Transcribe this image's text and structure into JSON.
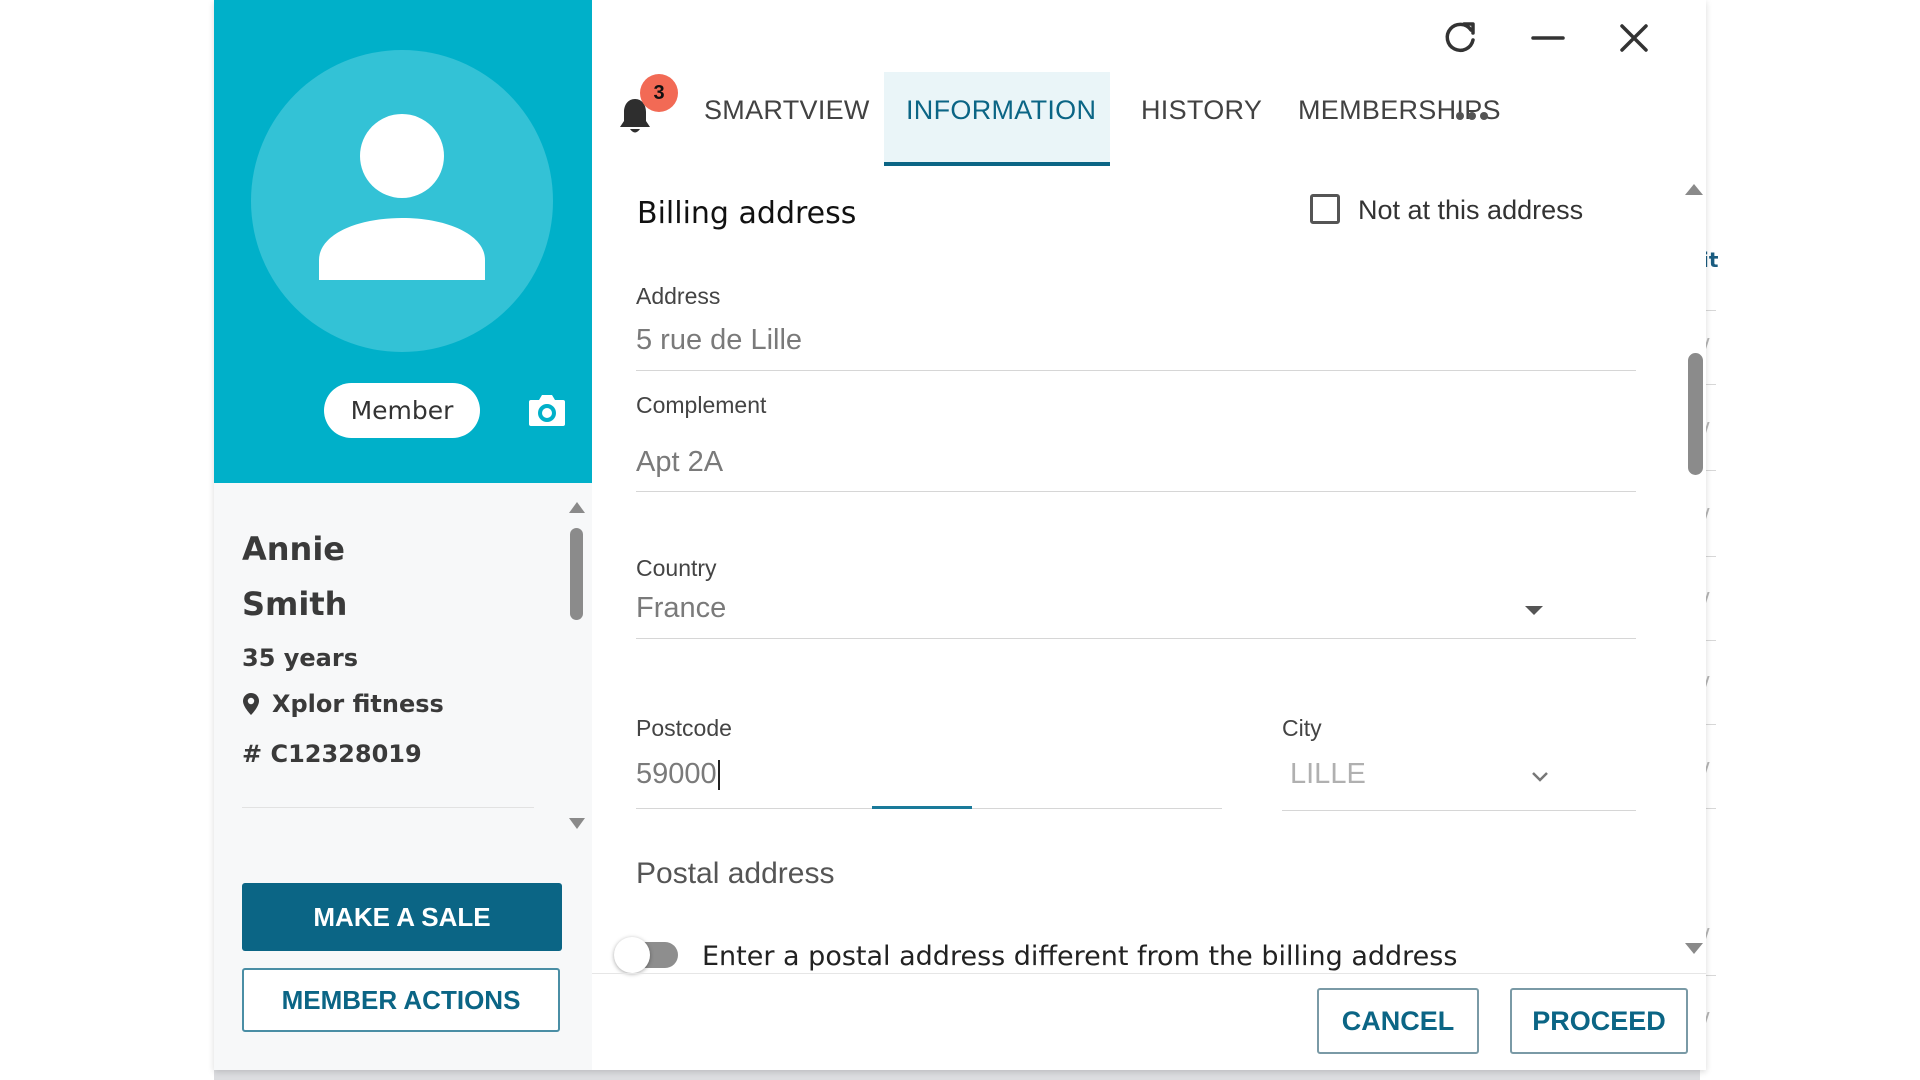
{
  "profile": {
    "status_badge": "Member",
    "first_name": "Annie",
    "last_name": "Smith",
    "age": "35 years",
    "club": "Xplor fitness",
    "member_id": "# C12328019"
  },
  "left_actions": {
    "make_sale": "MAKE A SALE",
    "member_actions": "MEMBER ACTIONS"
  },
  "notifications": {
    "count": "3"
  },
  "tabs": [
    {
      "label": "SMARTVIEW",
      "active": false
    },
    {
      "label": "INFORMATION",
      "active": true
    },
    {
      "label": "HISTORY",
      "active": false
    },
    {
      "label": "MEMBERSHIPS",
      "active": false
    }
  ],
  "billing": {
    "title": "Billing address",
    "not_at_address_label": "Not at this address",
    "not_at_address_checked": false,
    "address_label": "Address",
    "address_value": "5 rue de Lille",
    "complement_label": "Complement",
    "complement_value": "Apt 2A",
    "country_label": "Country",
    "country_value": "France",
    "postcode_label": "Postcode",
    "postcode_value": "59000",
    "city_label": "City",
    "city_value": "LILLE"
  },
  "postal": {
    "title": "Postal address",
    "toggle_label": "Enter a postal address different from the billing address",
    "toggle_on": false
  },
  "footer": {
    "cancel": "CANCEL",
    "proceed": "PROCEED"
  },
  "colors": {
    "hero": "#00b0c9",
    "primary": "#0b6585",
    "badge": "#f26a55"
  }
}
